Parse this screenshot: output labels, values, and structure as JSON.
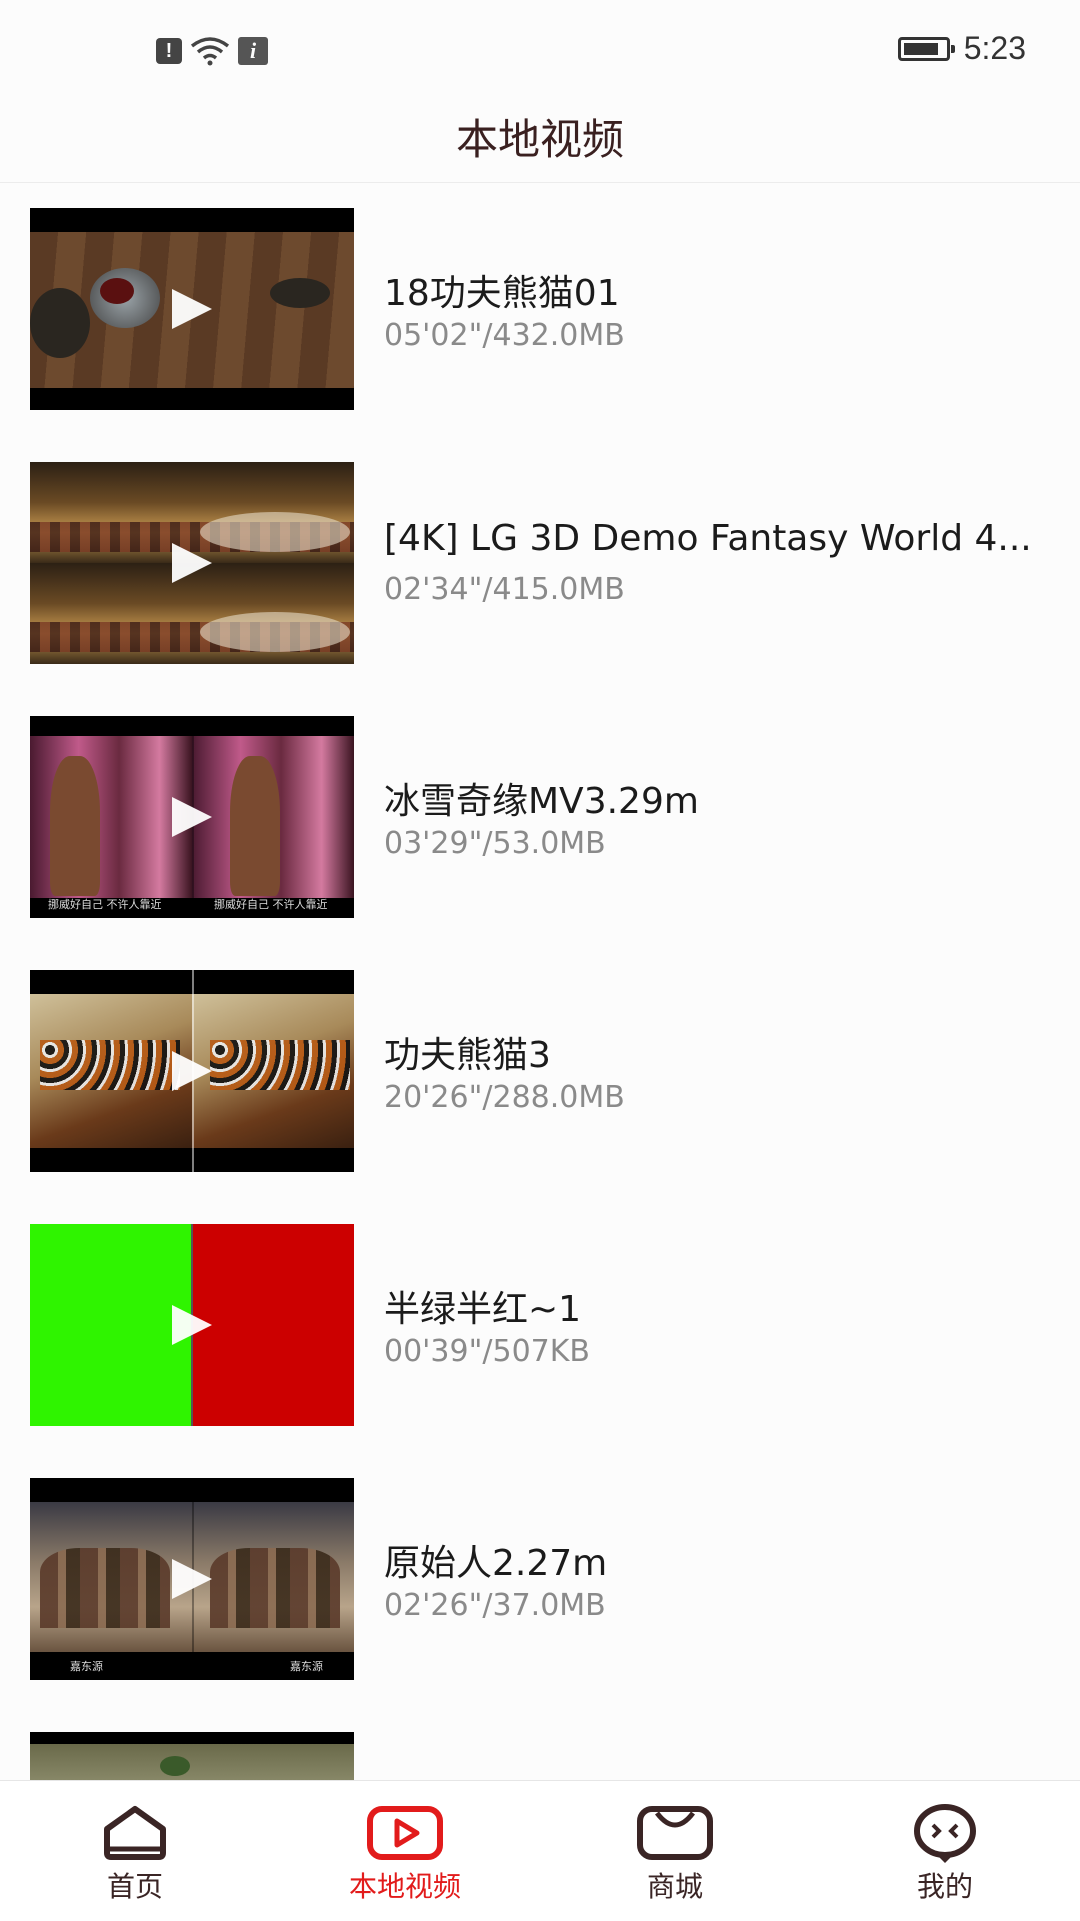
{
  "status_bar": {
    "time": "5:23",
    "battery_level": 0.85,
    "left_icons": [
      "alert-icon",
      "wifi-icon",
      "info-icon"
    ]
  },
  "header": {
    "title": "本地视频"
  },
  "videos": [
    {
      "title": "18功夫熊猫01",
      "meta": "05'02\"/432.0MB"
    },
    {
      "title": "[4K] LG 3D Demo Fantasy World 4...",
      "meta": "02'34\"/415.0MB"
    },
    {
      "title": "冰雪奇缘MV3.29m",
      "meta": "03'29\"/53.0MB"
    },
    {
      "title": "功夫熊猫3",
      "meta": "20'26\"/288.0MB"
    },
    {
      "title": "半绿半红~1",
      "meta": "00'39\"/507KB"
    },
    {
      "title": "原始人2.27m",
      "meta": "02'26\"/37.0MB"
    },
    {
      "title": "",
      "meta": ""
    }
  ],
  "thumb_subtitles": {
    "frozen_left": "挪威好自己 不许人靠近",
    "frozen_right": "挪威好自己 不许人靠近",
    "croods_left": "嘉东源",
    "croods_right": "嘉东源"
  },
  "bottom_nav": [
    {
      "label": "首页",
      "icon": "home-icon",
      "active": false
    },
    {
      "label": "本地视频",
      "icon": "play-icon",
      "active": true
    },
    {
      "label": "商城",
      "icon": "shop-icon",
      "active": false
    },
    {
      "label": "我的",
      "icon": "profile-icon",
      "active": false
    }
  ],
  "colors": {
    "accent": "#e21b1b",
    "nav_dark": "#3a2525",
    "meta_gray": "#8a8a8a"
  }
}
